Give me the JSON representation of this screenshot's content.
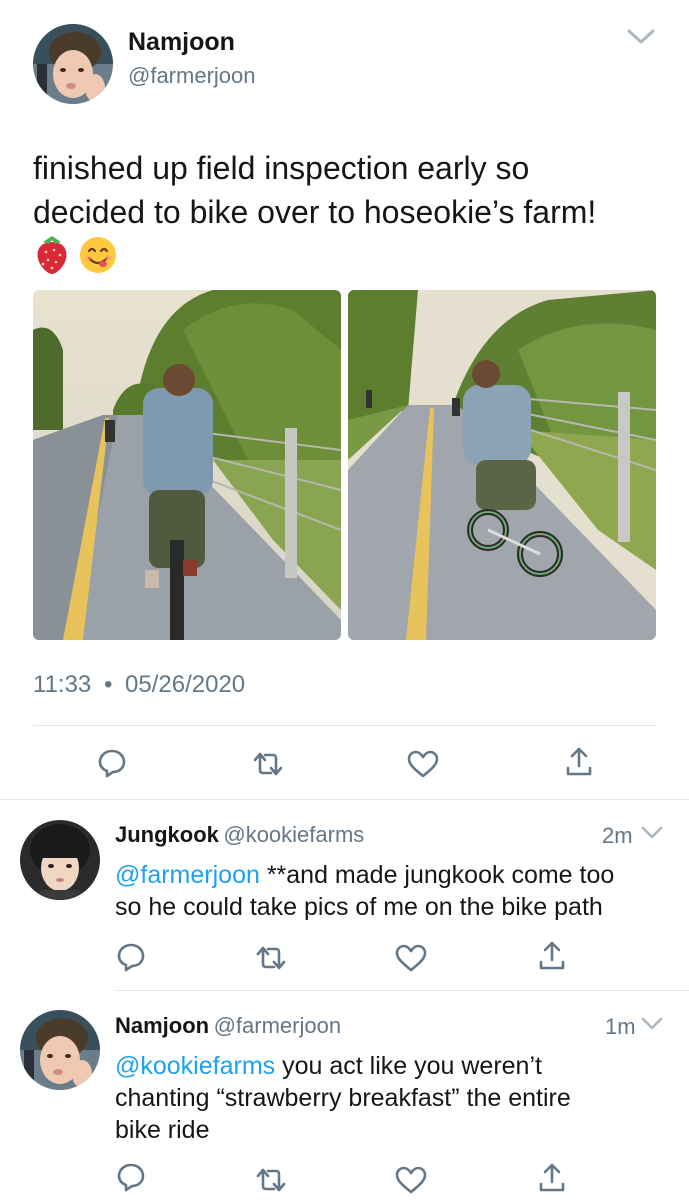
{
  "main_tweet": {
    "author_name": "Namjoon",
    "author_handle": "@farmerjoon",
    "text_line1": "finished up field inspection early so",
    "text_line2": "decided to bike over to hoseokie’s farm!",
    "emojis": "🍓 😋",
    "time": "11:33",
    "separator": "•",
    "date": "05/26/2020"
  },
  "replies": [
    {
      "author_name": "Jungkook",
      "author_handle": "@kookiefarms",
      "time": "2m",
      "mention": "@farmerjoon",
      "text_after_mention": " **and made jungkook come too",
      "text_line2": "so he could take pics of me on the bike path"
    },
    {
      "author_name": "Namjoon",
      "author_handle": "@farmerjoon",
      "time": "1m",
      "mention": "@kookiefarms",
      "text_after_mention": " you act like you weren’t",
      "text_line2": "chanting “strawberry breakfast” the entire",
      "text_line3": "bike ride"
    }
  ],
  "icons": {
    "reply": "reply-icon",
    "retweet": "retweet-icon",
    "like": "heart-icon",
    "share": "share-icon",
    "menu": "chevron-down-icon"
  },
  "colors": {
    "link": "#1da1f2",
    "secondary": "#657786",
    "divider": "#e1e8ed"
  }
}
